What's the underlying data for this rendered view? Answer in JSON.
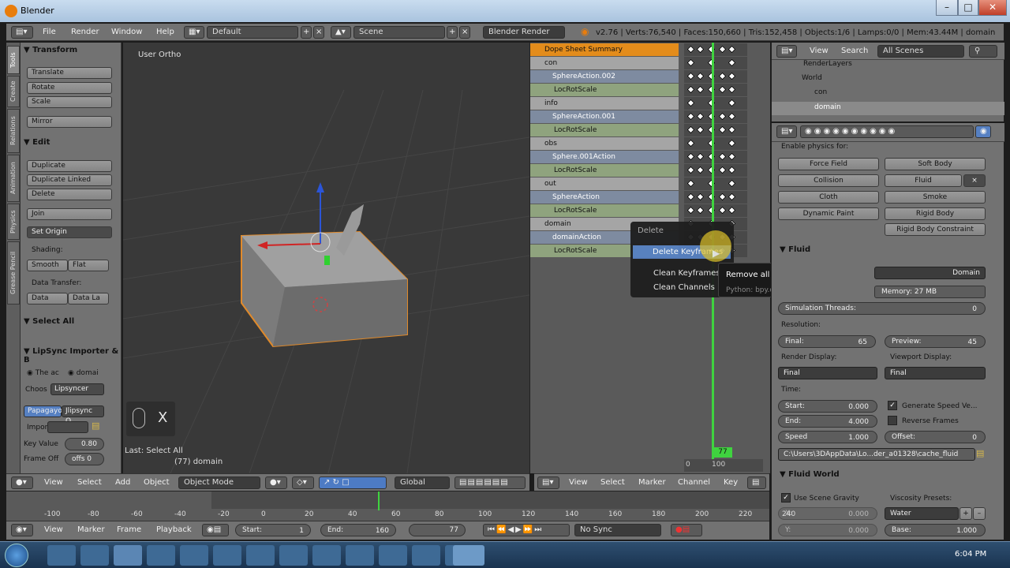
{
  "window": {
    "title": "Blender"
  },
  "info_header": {
    "menus": [
      "File",
      "Render",
      "Window",
      "Help"
    ],
    "layout": "Default",
    "scene": "Scene",
    "engine": "Blender Render",
    "stats": "v2.76 | Verts:76,540 | Faces:150,660 | Tris:152,458 | Objects:1/6 | Lamps:0/0 | Mem:43.44M | domain"
  },
  "tool_tabs": [
    "Tools",
    "Create",
    "Relations",
    "Animation",
    "Physics",
    "Grease Pencil"
  ],
  "tools": {
    "transform_header": "Transform",
    "translate": "Translate",
    "rotate": "Rotate",
    "scale": "Scale",
    "mirror": "Mirror",
    "edit_header": "Edit",
    "duplicate": "Duplicate",
    "duplicate_linked": "Duplicate Linked",
    "delete": "Delete",
    "join": "Join",
    "set_origin": "Set Origin",
    "shading_label": "Shading:",
    "smooth": "Smooth",
    "flat": "Flat",
    "data_transfer_label": "Data Transfer:",
    "data": "Data",
    "data_la": "Data La",
    "select_all_header": "Select All",
    "lipsync_header": "LipSync Importer & B",
    "the_ac": "The ac",
    "domai": "domai",
    "choos": "Choos",
    "lipsyncer": "Lipsyncer",
    "papagayo": "Papagayo",
    "jlipsync": "Jlipsync O...",
    "import": "Import",
    "key_value_label": "Key Value",
    "key_value": "0.80",
    "frame_off_label": "Frame Off",
    "frame_off": "offs 0"
  },
  "viewport": {
    "view_label": "User Ortho",
    "key_hint": "X",
    "last_op": "Last: Select All",
    "object_info": "(77) domain",
    "header": {
      "menus": [
        "View",
        "Select",
        "Add",
        "Object"
      ],
      "mode": "Object Mode",
      "orientation": "Global"
    }
  },
  "dopesheet": {
    "rows": [
      {
        "label": "Dope Sheet Summary",
        "kind": "sum"
      },
      {
        "label": "con",
        "kind": "obj"
      },
      {
        "label": "SphereAction.002",
        "kind": "act"
      },
      {
        "label": "LocRotScale",
        "kind": "ch"
      },
      {
        "label": "info",
        "kind": "obj"
      },
      {
        "label": "SphereAction.001",
        "kind": "act"
      },
      {
        "label": "LocRotScale",
        "kind": "ch"
      },
      {
        "label": "obs",
        "kind": "obj"
      },
      {
        "label": "Sphere.001Action",
        "kind": "act"
      },
      {
        "label": "LocRotScale",
        "kind": "ch"
      },
      {
        "label": "out",
        "kind": "obj"
      },
      {
        "label": "SphereAction",
        "kind": "act"
      },
      {
        "label": "LocRotScale",
        "kind": "ch"
      },
      {
        "label": "domain",
        "kind": "obj"
      },
      {
        "label": "domainAction",
        "kind": "act"
      },
      {
        "label": "LocRotScale",
        "kind": "ch"
      }
    ],
    "frame_marker": "77",
    "ruler": [
      "0",
      "100"
    ],
    "header": {
      "menus": [
        "View",
        "Select",
        "Marker",
        "Channel",
        "Key"
      ]
    }
  },
  "popup": {
    "title": "Delete",
    "items": [
      "Delete Keyframes",
      "Clean Keyframes",
      "Clean Channels"
    ],
    "tooltip": "Remove all selected keyframes",
    "tooltip_python": "Python: bpy.ops.action.delete()"
  },
  "outliner": {
    "menus": [
      "View",
      "Search"
    ],
    "filter": "All Scenes",
    "items": [
      "RenderLayers",
      "World",
      "con",
      "domain"
    ]
  },
  "properties": {
    "enable_physics": "Enable physics for:",
    "physics_buttons": [
      "Force Field",
      "Soft Body",
      "Collision",
      "Fluid",
      "Cloth",
      "Smoke",
      "Dynamic Paint",
      "Rigid Body"
    ],
    "rigid_body_constraint": "Rigid Body Constraint",
    "fluid_header": "Fluid",
    "type_value": "Domain",
    "memory": "Memory: 27 MB",
    "sim_threads_label": "Simulation Threads:",
    "sim_threads": "0",
    "resolution_label": "Resolution:",
    "final_label": "Final:",
    "final": "65",
    "preview_label": "Preview:",
    "preview": "45",
    "render_display_label": "Render Display:",
    "render_display": "Final",
    "viewport_display_label": "Viewport Display:",
    "viewport_display": "Final",
    "time_label": "Time:",
    "start_label": "Start:",
    "start": "0.000",
    "end_label": "End:",
    "end": "4.000",
    "speed_label": "Speed",
    "speed": "1.000",
    "offset_label": "Offset:",
    "offset": "0",
    "gen_speed": "Generate Speed Ve...",
    "reverse": "Reverse Frames",
    "cache_path": "C:\\Users\\3DAppData\\Lo...der_a01328\\cache_fluid",
    "fluid_world_header": "Fluid World",
    "use_scene_gravity": "Use Scene Gravity",
    "viscosity_presets": "Viscosity Presets:",
    "water": "Water",
    "x_label": "X:",
    "x": "0.000",
    "y_label": "Y:",
    "y": "0.000",
    "base_label": "Base:",
    "base": "1.000"
  },
  "timeline": {
    "ticks": [
      "-100",
      "-80",
      "-60",
      "-40",
      "-20",
      "0",
      "20",
      "40",
      "60",
      "80",
      "100",
      "120",
      "140",
      "160",
      "180",
      "200",
      "220",
      "240"
    ],
    "menus": [
      "View",
      "Marker",
      "Frame",
      "Playback"
    ],
    "start_label": "Start:",
    "start": "1",
    "end_label": "End:",
    "end": "160",
    "current": "77",
    "sync": "No Sync"
  },
  "taskbar": {
    "clock": "6:04 PM"
  }
}
